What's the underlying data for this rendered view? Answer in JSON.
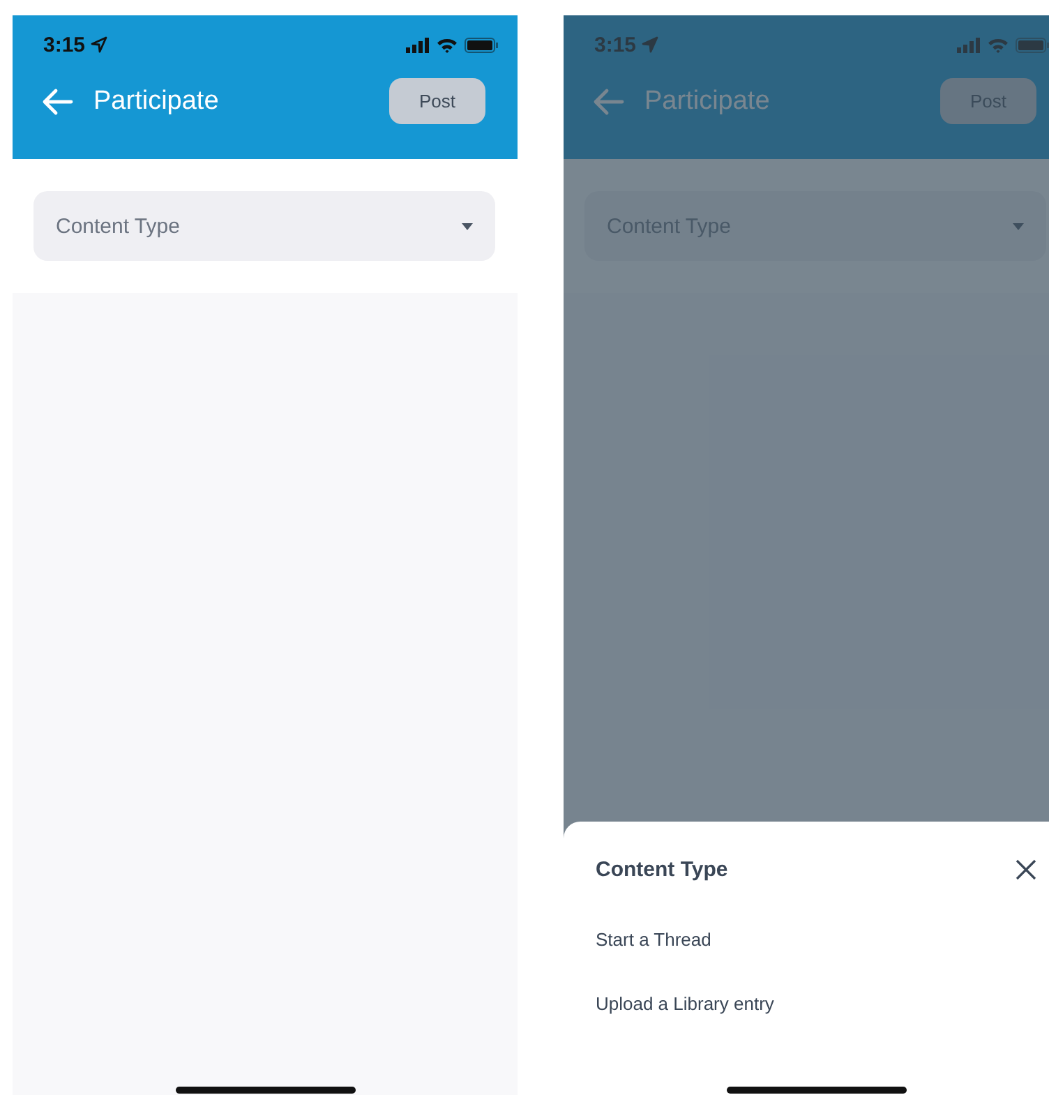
{
  "screens": [
    {
      "status_time": "3:15",
      "title": "Participate",
      "post_button": {
        "label": "Post",
        "disabled": true
      },
      "select": {
        "placeholder": "Content Type"
      },
      "dimmed": false
    },
    {
      "status_time": "3:15",
      "title": "Participate",
      "post_button": {
        "label": "Post",
        "disabled": true
      },
      "select": {
        "placeholder": "Content Type"
      },
      "dimmed": true,
      "sheet": {
        "title": "Content Type",
        "options": [
          {
            "label": "Start a Thread"
          },
          {
            "label": "Upload a Library entry"
          }
        ]
      }
    }
  ]
}
